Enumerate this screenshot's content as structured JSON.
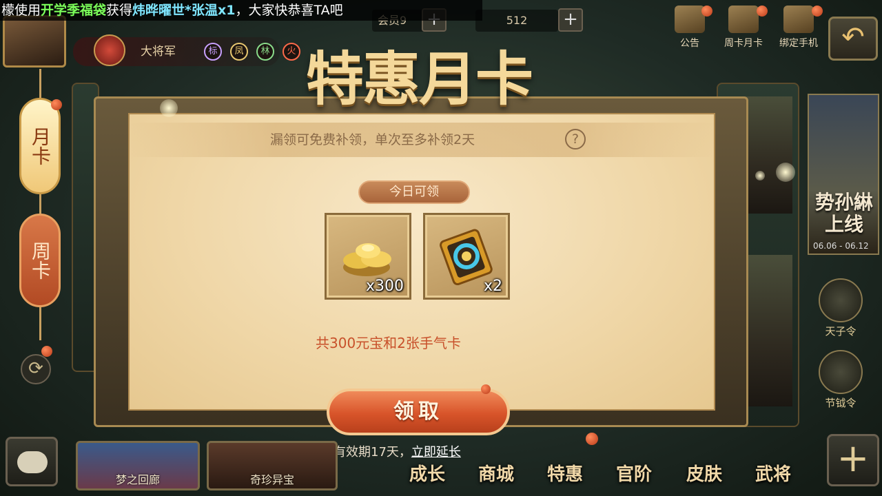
{
  "marquee": {
    "prefix": "檬使用",
    "item": "开学季福袋",
    "middle": "获得",
    "reward": "炜晔曜世*张温x1",
    "suffix": "，大家快恭喜TA吧"
  },
  "player": {
    "rank_name": "大将军",
    "badges": [
      {
        "label": "标",
        "color": "#c8a0ff"
      },
      {
        "label": "凤",
        "color": "#e8c870"
      },
      {
        "label": "林",
        "color": "#8adc8a"
      },
      {
        "label": "火",
        "color": "#ff6a4a"
      }
    ],
    "currency_label": "会员9",
    "currency_value": "512"
  },
  "top_menu": [
    {
      "label": "公告",
      "icon": "scroll-icon"
    },
    {
      "label": "周卡月卡",
      "icon": "card-icon"
    },
    {
      "label": "绑定手机",
      "icon": "phone-icon"
    }
  ],
  "left_tabs": {
    "monthly": "月卡",
    "weekly": "周卡"
  },
  "title": "特惠月卡",
  "panel": {
    "notice": "漏领可免费补领，单次至多补领2天",
    "help": "?",
    "today_label": "今日可领",
    "items": [
      {
        "name": "gold-ingot",
        "quantity": "x300"
      },
      {
        "name": "luck-card",
        "quantity": "x2"
      }
    ],
    "total": "共300元宝和2张手气卡",
    "claim_button": "领取",
    "validity_prefix": "有效期17天，",
    "extend_link": "立即延长"
  },
  "right_side": {
    "event_title": "势孙綝上线",
    "event_date": "06.06 - 06.12",
    "icons": [
      {
        "label": "天子令"
      },
      {
        "label": "节钺令"
      }
    ]
  },
  "bottom": {
    "cards": [
      {
        "label": "梦之回廊"
      },
      {
        "label": "奇珍异宝"
      }
    ],
    "nav": [
      "成长",
      "商城",
      "特惠",
      "官阶",
      "皮肤",
      "武将"
    ],
    "plus": "+"
  },
  "colors": {
    "accent_gold": "#f4d89a",
    "claim_red": "#d8542a",
    "total_text": "#c8502a"
  }
}
